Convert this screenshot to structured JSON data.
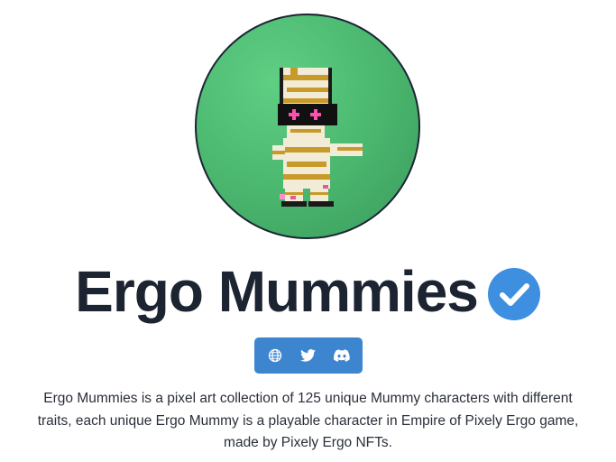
{
  "collection": {
    "name": "Ergo Mummies",
    "verified_icon": "verified-check-icon",
    "description": "Ergo Mummies is a pixel art collection of 125 unique Mummy characters with different traits, each unique Ergo Mummy is a playable character in Empire of Pixely Ergo game, made by Pixely Ergo NFTs."
  },
  "social": [
    {
      "icon": "globe-icon",
      "name": "website"
    },
    {
      "icon": "twitter-icon",
      "name": "twitter"
    },
    {
      "icon": "discord-icon",
      "name": "discord"
    }
  ],
  "colors": {
    "avatar_bg": "#4cb86f",
    "social_bar": "#3d86cf",
    "verified": "#3f8fe0",
    "title": "#1c2331"
  }
}
